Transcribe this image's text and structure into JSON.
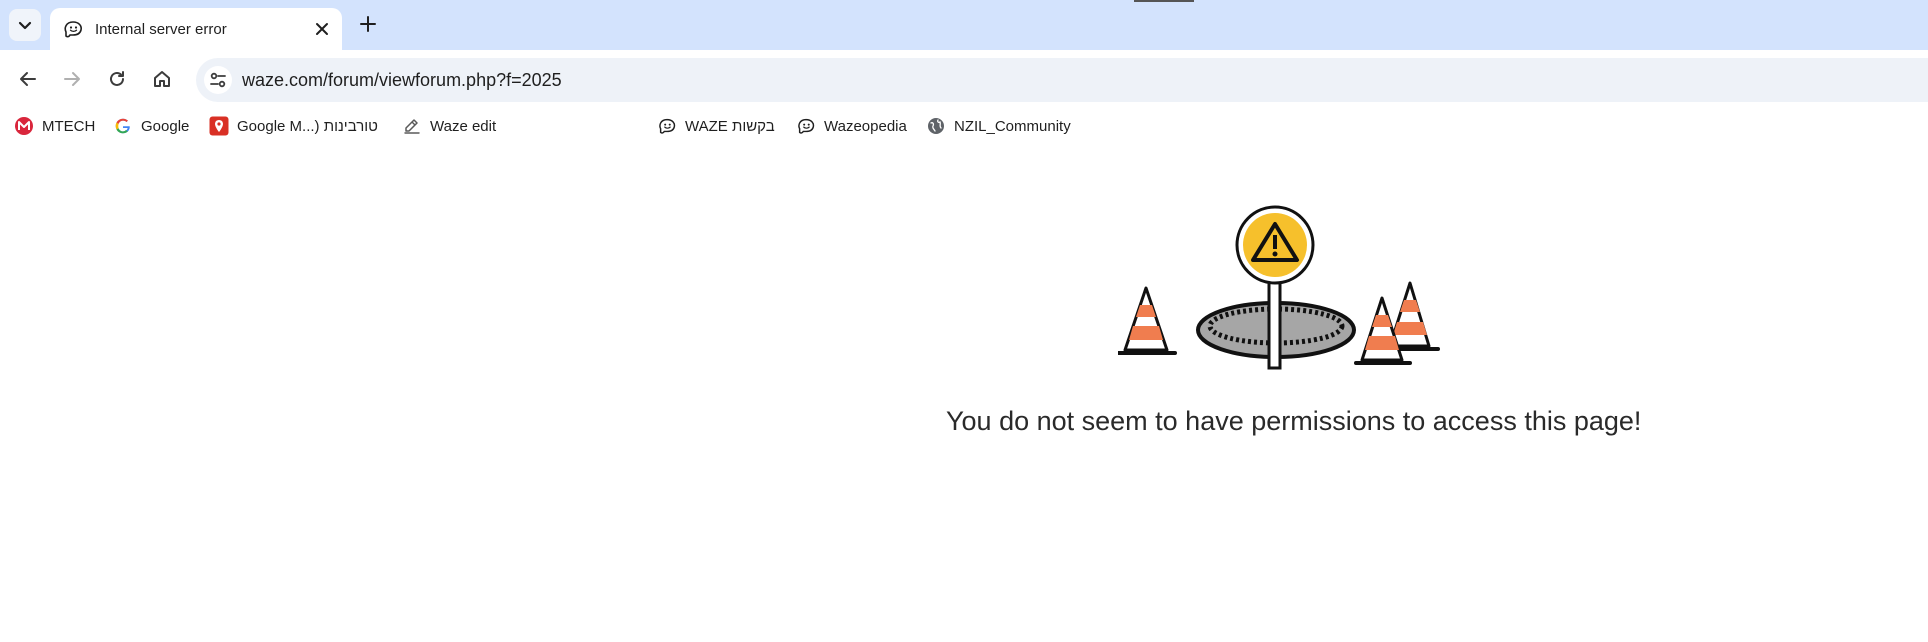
{
  "tab": {
    "title": "Internal server error",
    "favicon": "waze-icon"
  },
  "address_bar": {
    "url": "waze.com/forum/viewforum.php?f=2025"
  },
  "bookmarks": [
    {
      "label": "MTECH",
      "icon": "mtech-icon"
    },
    {
      "label": "Google",
      "icon": "google-icon"
    },
    {
      "label": "Google M...) טורבינות",
      "icon": "google-maps-icon"
    },
    {
      "label": "Waze edit",
      "icon": "edit-icon"
    },
    {
      "label": "WAZE בקשות",
      "icon": "waze-icon"
    },
    {
      "label": "Wazeopedia",
      "icon": "waze-icon"
    },
    {
      "label": "NZIL_Community",
      "icon": "globe-icon"
    }
  ],
  "page": {
    "message": "You do not seem to have permissions to access this page!"
  },
  "colors": {
    "tabstrip": "#d3e3fd",
    "omnibox": "#eef2f8",
    "sign_yellow": "#f6c02c",
    "cone_orange": "#f07d4f"
  }
}
